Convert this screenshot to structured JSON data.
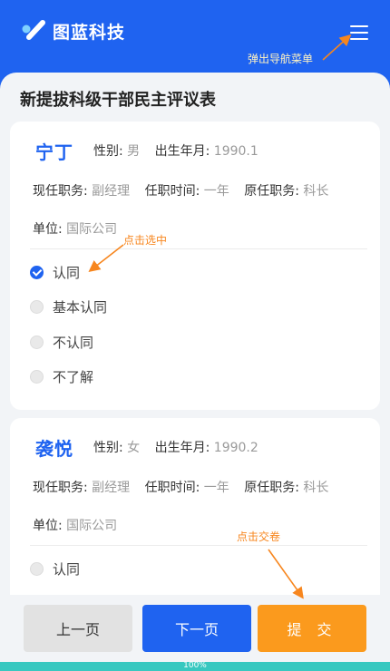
{
  "app": {
    "brand": "图蓝科技"
  },
  "page": {
    "title": "新提拔科级干部民主评议表"
  },
  "annotations": {
    "menu": "弹出导航菜单",
    "select": "点击选中",
    "submit": "点击交卷"
  },
  "labels": {
    "gender": "性别:",
    "birth": "出生年月:",
    "current_post": "现任职务:",
    "tenure": "任职时间:",
    "former_post": "原任职务:",
    "unit": "单位:"
  },
  "candidates": [
    {
      "name": "宁丁",
      "gender": "男",
      "birth": "1990.1",
      "current_post": "副经理",
      "tenure": "一年",
      "former_post": "科长",
      "unit": "国际公司",
      "options": [
        {
          "label": "认同",
          "selected": true
        },
        {
          "label": "基本认同",
          "selected": false
        },
        {
          "label": "不认同",
          "selected": false
        },
        {
          "label": "不了解",
          "selected": false
        }
      ]
    },
    {
      "name": "袭悦",
      "gender": "女",
      "birth": "1990.2",
      "current_post": "副经理",
      "tenure": "一年",
      "former_post": "科长",
      "unit": "国际公司",
      "options": [
        {
          "label": "认同",
          "selected": false
        }
      ]
    }
  ],
  "footer": {
    "prev": "上一页",
    "next": "下一页",
    "submit": "提 交"
  },
  "progress": {
    "text": "100%",
    "value": 1.0
  },
  "colors": {
    "primary": "#1f63f0",
    "accent": "#fb9a1d",
    "progress": "#38c8c0",
    "annotation": "#f7861e"
  },
  "icons": {
    "logo": "brand-logo-icon",
    "menu": "hamburger-menu-icon",
    "check": "check-icon"
  }
}
